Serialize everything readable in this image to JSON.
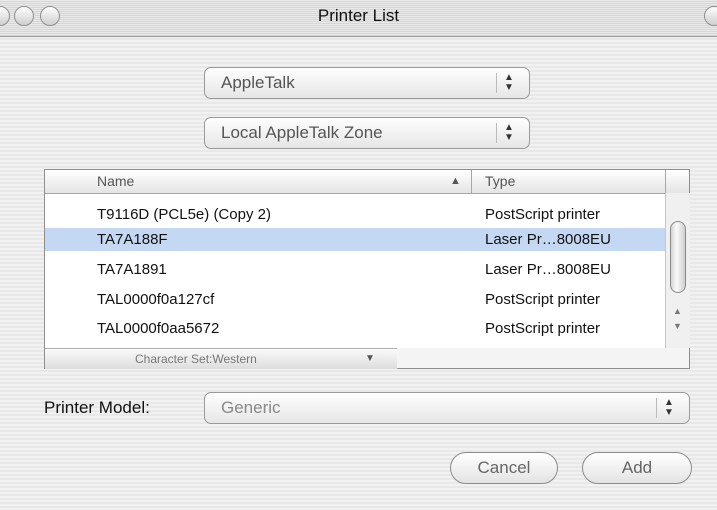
{
  "window": {
    "title": "Printer List"
  },
  "popups": {
    "connection": "AppleTalk",
    "zone": "Local AppleTalk Zone",
    "model_label": "Printer Model:",
    "model": "Generic"
  },
  "table": {
    "headers": {
      "name": "Name",
      "sort_indicator": "▲",
      "type": "Type"
    },
    "rows": [
      {
        "name": "T9116D (PCL5e) (Copy 2)",
        "type": "PostScript printer",
        "selected": false
      },
      {
        "name": "TA7A188F",
        "type": "Laser Pr…8008EU",
        "selected": true
      },
      {
        "name": "TA7A1891",
        "type": "Laser Pr…8008EU",
        "selected": false
      },
      {
        "name": "TAL0000f0a127cf",
        "type": "PostScript printer",
        "selected": false
      },
      {
        "name": "TAL0000f0aa5672",
        "type": "PostScript printer",
        "selected": false
      }
    ],
    "charset": "Character Set:Western"
  },
  "buttons": {
    "cancel": "Cancel",
    "add": "Add"
  },
  "icons": {
    "stepper": "up-down-arrows-icon",
    "dropdown": "triangle-down-icon",
    "scroll_up": "scroll-up-arrow-icon",
    "scroll_down": "scroll-down-arrow-icon"
  }
}
